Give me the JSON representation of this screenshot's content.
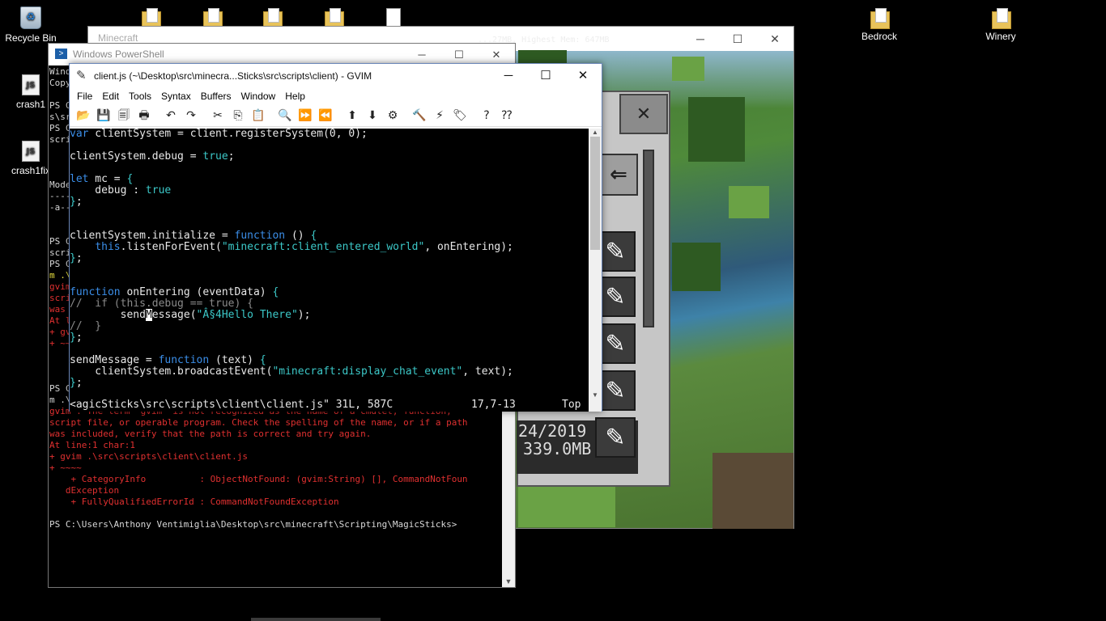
{
  "desktop": {
    "icons": [
      {
        "label": "Recycle Bin",
        "type": "recycle-bin"
      },
      {
        "label": "crash1",
        "type": "js"
      },
      {
        "label": "crash1fix",
        "type": "js"
      },
      {
        "label": "Bedrock",
        "type": "folder"
      },
      {
        "label": "Winery",
        "type": "folder"
      }
    ]
  },
  "minecraft": {
    "title": "Minecraft",
    "debug_text": "...27MB, Highest Mem: 647MB",
    "list_date": "24/2019",
    "list_size": "339.0MB",
    "close_glyph": "✕",
    "back_glyph": "⇐",
    "edit_glyph": "✎"
  },
  "powershell": {
    "title": "Windows PowerShell",
    "lines": [
      {
        "t": "Wind",
        "c": ""
      },
      {
        "t": "Copy",
        "c": ""
      },
      {
        "t": "",
        "c": ""
      },
      {
        "t": "PS C",
        "c": ""
      },
      {
        "t": "s\\sr",
        "c": ""
      },
      {
        "t": "PS C",
        "c": ""
      },
      {
        "t": "scri",
        "c": ""
      },
      {
        "t": "",
        "c": ""
      },
      {
        "t": "",
        "c": ""
      },
      {
        "t": "",
        "c": ""
      },
      {
        "t": "Mode",
        "c": ""
      },
      {
        "t": "----",
        "c": ""
      },
      {
        "t": "-a--",
        "c": ""
      },
      {
        "t": "",
        "c": ""
      },
      {
        "t": "",
        "c": ""
      },
      {
        "t": "PS C",
        "c": ""
      },
      {
        "t": "scri",
        "c": ""
      },
      {
        "t": "PS C",
        "c": ""
      },
      {
        "t": "m .\\",
        "c": "yel"
      },
      {
        "t": "gvim",
        "c": "red"
      },
      {
        "t": "scri",
        "c": "red"
      },
      {
        "t": "was ",
        "c": "red"
      },
      {
        "t": "At l",
        "c": "red"
      },
      {
        "t": "+ gv",
        "c": "red"
      },
      {
        "t": "+ ~~",
        "c": "red"
      },
      {
        "t": "",
        "c": ""
      },
      {
        "t": "    + FullyQualifiedErrorId : CommandNotFoundException",
        "c": "red"
      },
      {
        "t": "",
        "c": ""
      },
      {
        "t": "PS C:\\Users\\Anthony Ventimiglia\\Desktop\\src\\minecraft\\Scripting\\MagicSticks> gvim",
        "c": "ps-gvim"
      },
      {
        "t": "m .\\src\\scripts\\client\\client.js",
        "c": ""
      },
      {
        "t": "gvim : The term 'gvim' is not recognized as the name of a cmdlet, function,",
        "c": "red"
      },
      {
        "t": "script file, or operable program. Check the spelling of the name, or if a path",
        "c": "red"
      },
      {
        "t": "was included, verify that the path is correct and try again.",
        "c": "red"
      },
      {
        "t": "At line:1 char:1",
        "c": "red"
      },
      {
        "t": "+ gvim .\\src\\scripts\\client\\client.js",
        "c": "red"
      },
      {
        "t": "+ ~~~~",
        "c": "red"
      },
      {
        "t": "    + CategoryInfo          : ObjectNotFound: (gvim:String) [], CommandNotFoun",
        "c": "red"
      },
      {
        "t": "   dException",
        "c": "red"
      },
      {
        "t": "    + FullyQualifiedErrorId : CommandNotFoundException",
        "c": "red"
      },
      {
        "t": "",
        "c": ""
      },
      {
        "t": "PS C:\\Users\\Anthony Ventimiglia\\Desktop\\src\\minecraft\\Scripting\\MagicSticks>",
        "c": ""
      }
    ]
  },
  "gvim": {
    "title": "client.js (~\\Desktop\\src\\minecra...Sticks\\src\\scripts\\client) - GVIM",
    "menu": [
      "File",
      "Edit",
      "Tools",
      "Syntax",
      "Buffers",
      "Window",
      "Help"
    ],
    "toolbar": [
      {
        "name": "open-icon",
        "glyph": "📂"
      },
      {
        "name": "save-icon",
        "glyph": "💾"
      },
      {
        "name": "save-all-icon",
        "glyph": "🗐"
      },
      {
        "name": "print-icon",
        "glyph": "🖶"
      },
      {
        "name": "sep"
      },
      {
        "name": "undo-icon",
        "glyph": "↶"
      },
      {
        "name": "redo-icon",
        "glyph": "↷"
      },
      {
        "name": "sep"
      },
      {
        "name": "cut-icon",
        "glyph": "✂"
      },
      {
        "name": "copy-icon",
        "glyph": "⎘"
      },
      {
        "name": "paste-icon",
        "glyph": "📋"
      },
      {
        "name": "sep"
      },
      {
        "name": "find-replace-icon",
        "glyph": "🔍"
      },
      {
        "name": "find-next-icon",
        "glyph": "⏩"
      },
      {
        "name": "find-prev-icon",
        "glyph": "⏪"
      },
      {
        "name": "sep"
      },
      {
        "name": "load-session-icon",
        "glyph": "⬆"
      },
      {
        "name": "save-session-icon",
        "glyph": "⬇"
      },
      {
        "name": "run-script-icon",
        "glyph": "⚙"
      },
      {
        "name": "sep"
      },
      {
        "name": "make-icon",
        "glyph": "🔨"
      },
      {
        "name": "shell-icon",
        "glyph": "⚡"
      },
      {
        "name": "tags-icon",
        "glyph": "🏷"
      },
      {
        "name": "sep"
      },
      {
        "name": "help-icon",
        "glyph": "?"
      },
      {
        "name": "find-help-icon",
        "glyph": "⁇"
      }
    ],
    "code": [
      [
        {
          "t": "var",
          "s": "kw"
        },
        {
          "t": " clientSystem = client.registerSystem(0, 0);",
          "s": ""
        }
      ],
      [],
      [
        {
          "t": "clientSystem.debug = ",
          "s": ""
        },
        {
          "t": "true",
          "s": "val"
        },
        {
          "t": ";",
          "s": ""
        }
      ],
      [],
      [
        {
          "t": "let",
          "s": "kw"
        },
        {
          "t": " mc = ",
          "s": ""
        },
        {
          "t": "{",
          "s": "val"
        }
      ],
      [
        {
          "t": "    debug : ",
          "s": ""
        },
        {
          "t": "true",
          "s": "val"
        }
      ],
      [
        {
          "t": "}",
          "s": "val"
        },
        {
          "t": ";",
          "s": ""
        }
      ],
      [],
      [],
      [
        {
          "t": "clientSystem.initialize = ",
          "s": ""
        },
        {
          "t": "function",
          "s": "kw"
        },
        {
          "t": " () ",
          "s": ""
        },
        {
          "t": "{",
          "s": "val"
        }
      ],
      [
        {
          "t": "    ",
          "s": ""
        },
        {
          "t": "this",
          "s": "kw"
        },
        {
          "t": ".listenForEvent(",
          "s": ""
        },
        {
          "t": "\"minecraft:client_entered_world\"",
          "s": "str"
        },
        {
          "t": ", onEntering);",
          "s": ""
        }
      ],
      [
        {
          "t": "}",
          "s": "val"
        },
        {
          "t": ";",
          "s": ""
        }
      ],
      [],
      [],
      [
        {
          "t": "function",
          "s": "kw"
        },
        {
          "t": " onEntering (eventData) ",
          "s": ""
        },
        {
          "t": "{",
          "s": "val"
        }
      ],
      [
        {
          "t": "//  if (this.debug == true) {",
          "s": "cmt"
        }
      ],
      [
        {
          "t": "        send",
          "s": ""
        },
        {
          "t": "M",
          "s": "cur"
        },
        {
          "t": "essage(",
          "s": ""
        },
        {
          "t": "\"Â§4Hello There\"",
          "s": "str"
        },
        {
          "t": ");",
          "s": ""
        }
      ],
      [
        {
          "t": "//  }",
          "s": "cmt"
        }
      ],
      [
        {
          "t": "}",
          "s": "val"
        },
        {
          "t": ";",
          "s": ""
        }
      ],
      [],
      [
        {
          "t": "sendMessage = ",
          "s": ""
        },
        {
          "t": "function",
          "s": "kw"
        },
        {
          "t": " (text) ",
          "s": ""
        },
        {
          "t": "{",
          "s": "val"
        }
      ],
      [
        {
          "t": "    clientSystem.broadcastEvent(",
          "s": ""
        },
        {
          "t": "\"minecraft:display_chat_event\"",
          "s": "str"
        },
        {
          "t": ", text);",
          "s": ""
        }
      ],
      [
        {
          "t": "}",
          "s": "val"
        },
        {
          "t": ";",
          "s": ""
        }
      ]
    ],
    "status": {
      "file": "<agicSticks\\src\\scripts\\client\\client.js\" 31L, 587C",
      "position": "17,7-13",
      "scroll": "Top"
    }
  },
  "window_controls": {
    "minimize": "─",
    "maximize": "☐",
    "close": "✕"
  }
}
